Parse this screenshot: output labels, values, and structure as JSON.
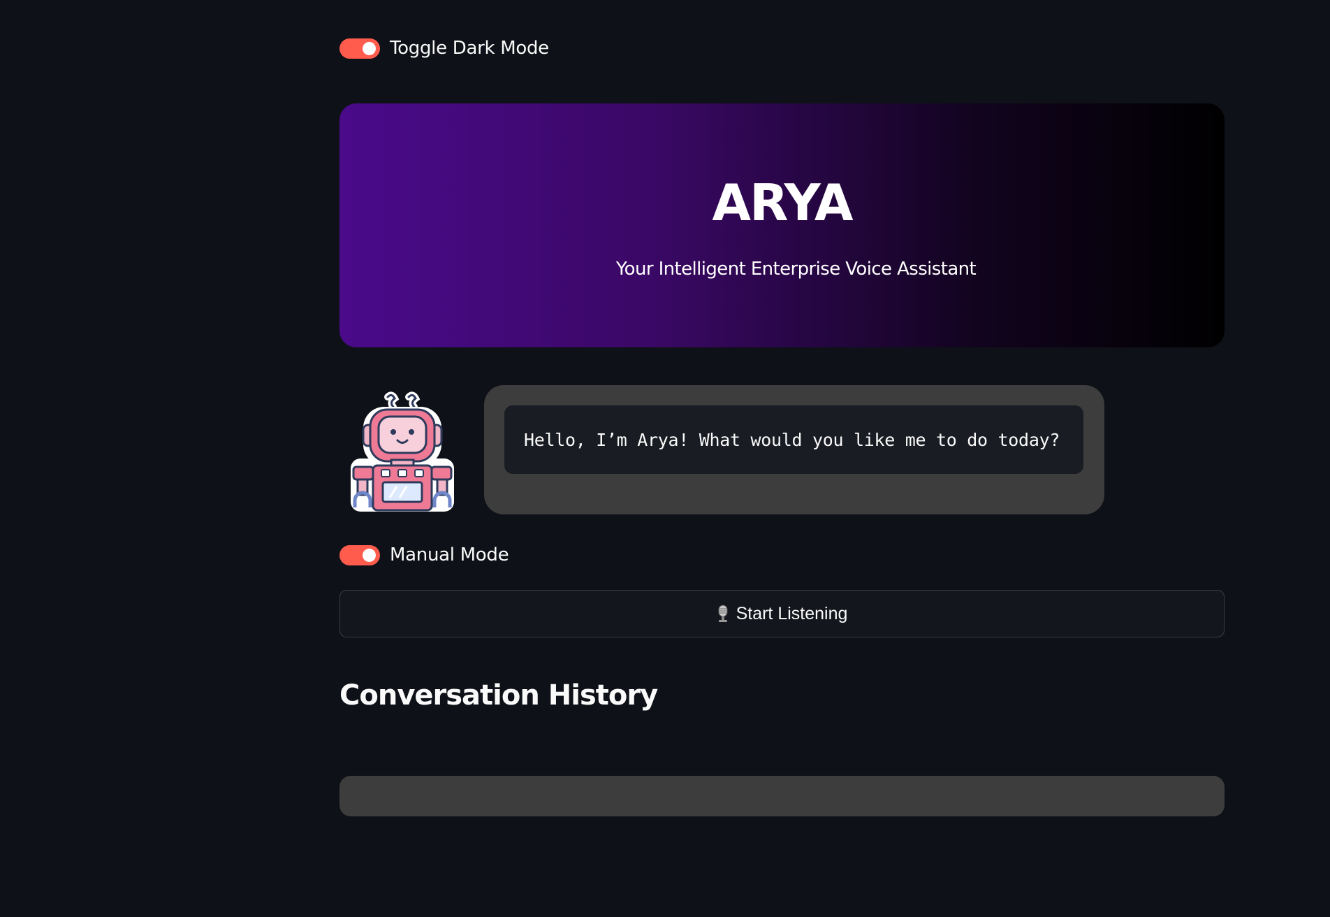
{
  "settings": {
    "dark_mode_label": "Toggle Dark Mode",
    "dark_mode_on": true,
    "manual_mode_label": "Manual Mode",
    "manual_mode_on": true
  },
  "hero": {
    "title": "ARYA",
    "subtitle": "Your Intelligent Enterprise Voice Assistant"
  },
  "assistant": {
    "avatar_icon": "robot-icon",
    "greeting": "Hello, I’m Arya! What would you like me to do today?"
  },
  "controls": {
    "listen_icon": "microphone-icon",
    "listen_label": "Start Listening"
  },
  "history": {
    "title": "Conversation History",
    "entries": []
  },
  "colors": {
    "toggle_on": "#ff5c4d",
    "page_background": "#0e1117",
    "panel": "#3d3d3d",
    "hero_start": "#4a0a8a",
    "hero_end": "#000000"
  }
}
